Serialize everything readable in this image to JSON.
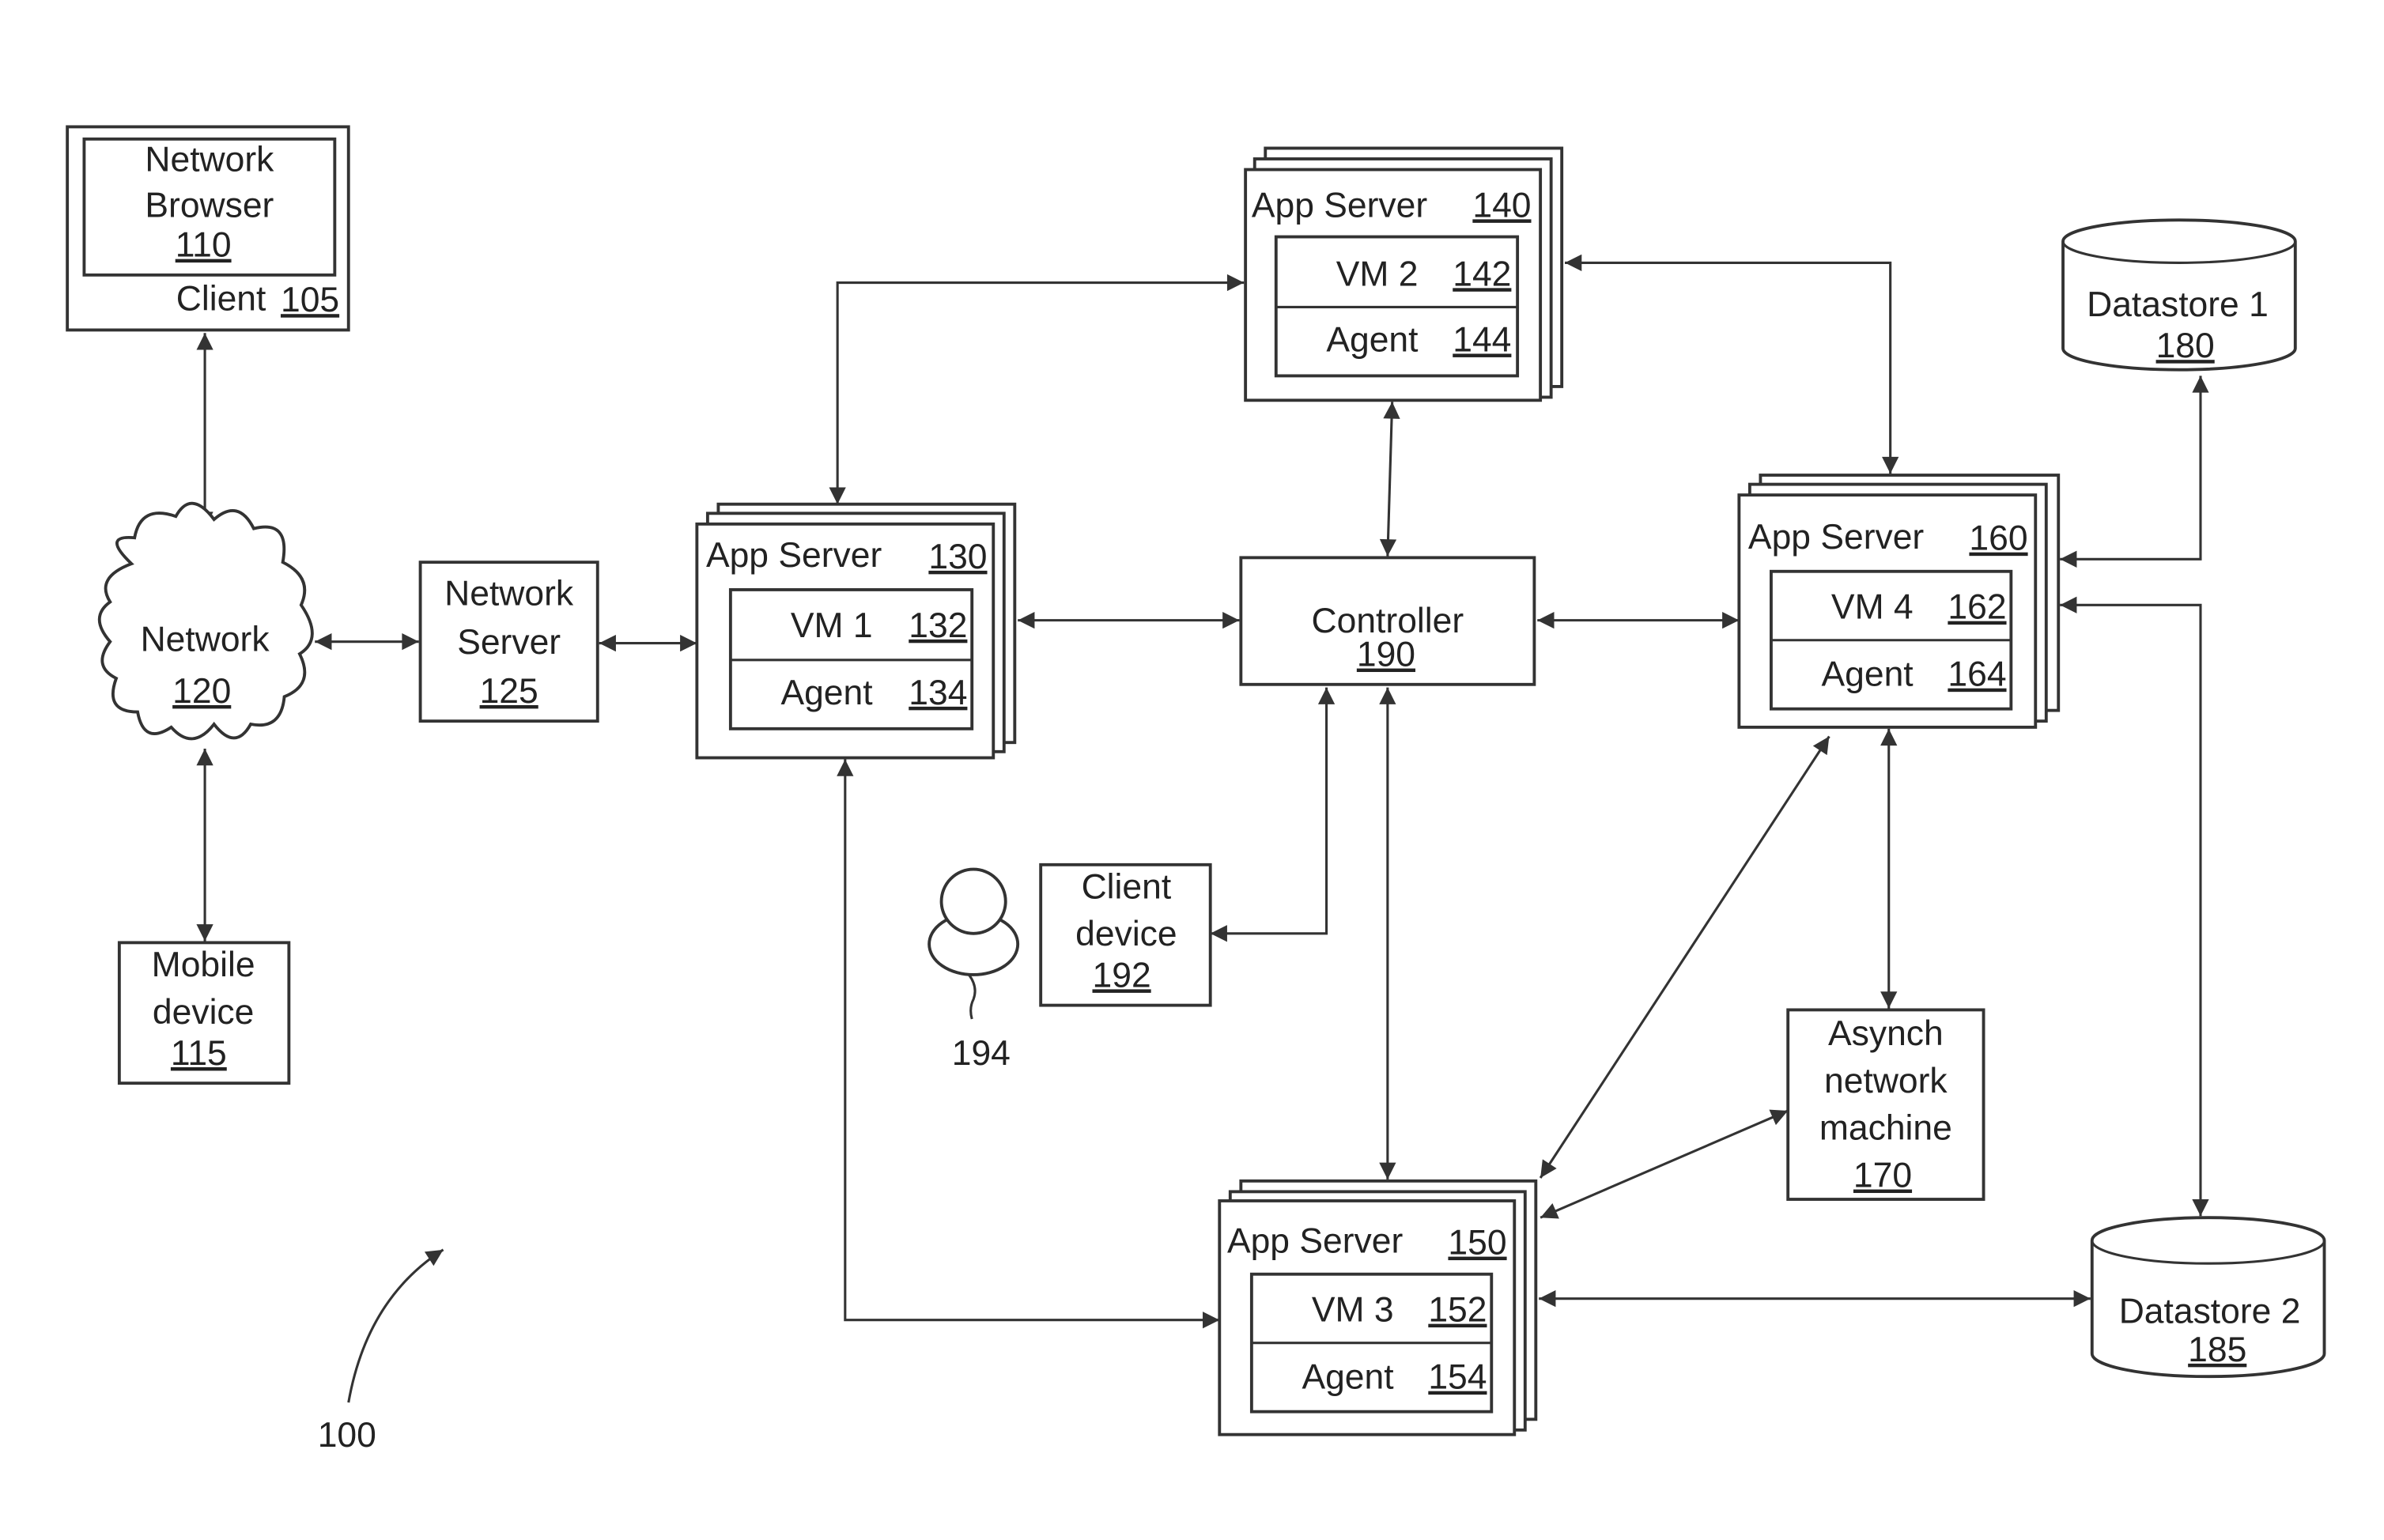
{
  "figure_number": "100",
  "nodes": {
    "client": {
      "label": "Client",
      "ref": "105"
    },
    "browser": {
      "line1": "Network",
      "line2": "Browser",
      "ref": "110"
    },
    "mobile": {
      "line1": "Mobile",
      "line2": "device",
      "ref": "115"
    },
    "network": {
      "label": "Network",
      "ref": "120"
    },
    "network_server": {
      "line1": "Network",
      "line2": "Server",
      "ref": "125"
    },
    "app130": {
      "label": "App Server",
      "ref": "130",
      "vm": "VM 1",
      "vm_ref": "132",
      "agent": "Agent",
      "agent_ref": "134"
    },
    "app140": {
      "label": "App Server",
      "ref": "140",
      "vm": "VM 2",
      "vm_ref": "142",
      "agent": "Agent",
      "agent_ref": "144"
    },
    "app150": {
      "label": "App Server",
      "ref": "150",
      "vm": "VM 3",
      "vm_ref": "152",
      "agent": "Agent",
      "agent_ref": "154"
    },
    "app160": {
      "label": "App Server",
      "ref": "160",
      "vm": "VM 4",
      "vm_ref": "162",
      "agent": "Agent",
      "agent_ref": "164"
    },
    "asynch": {
      "line1": "Asynch",
      "line2": "network",
      "line3": "machine",
      "ref": "170"
    },
    "ds1": {
      "label": "Datastore 1",
      "ref": "180"
    },
    "ds2": {
      "label": "Datastore 2",
      "ref": "185"
    },
    "controller": {
      "label": "Controller",
      "ref": "190"
    },
    "client_device": {
      "line1": "Client",
      "line2": "device",
      "ref": "192"
    },
    "user": {
      "ref": "194"
    }
  }
}
